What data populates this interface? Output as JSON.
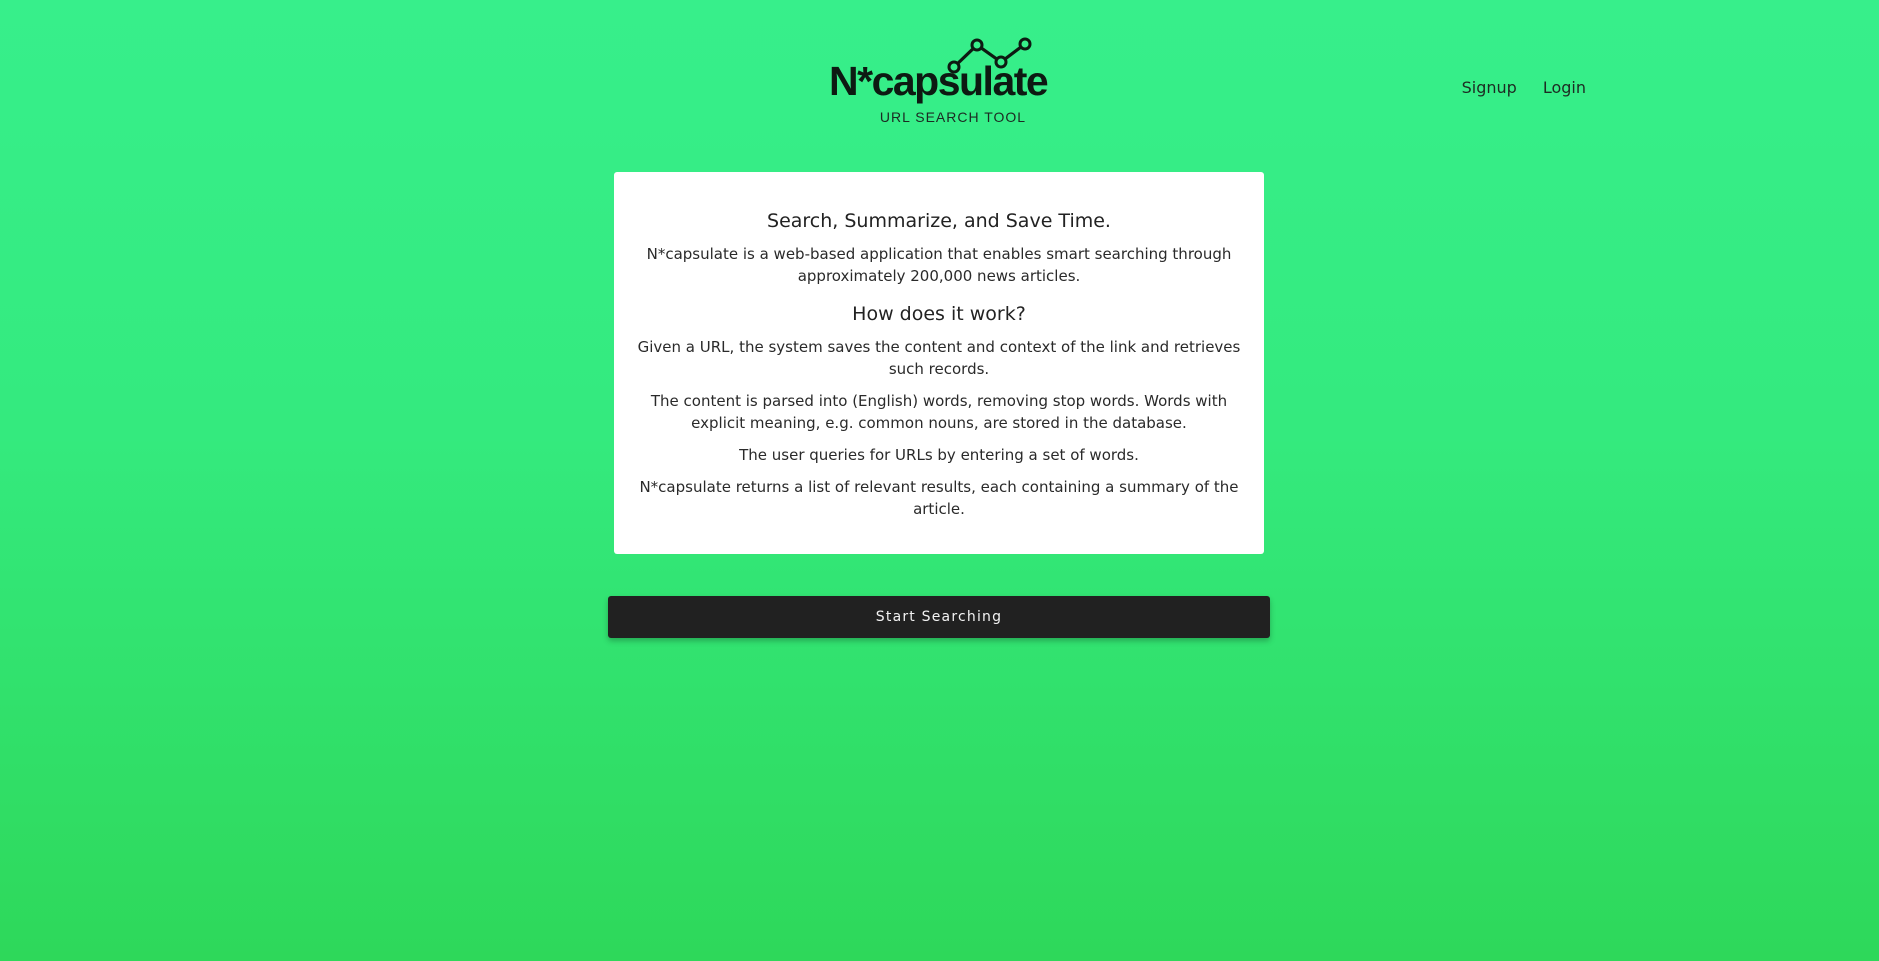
{
  "logo": {
    "wordmark": "N*capsulate",
    "subtitle": "URL SEARCH TOOL",
    "icon": "line-chart-icon"
  },
  "nav": {
    "signup": "Signup",
    "login": "Login"
  },
  "card": {
    "heading": "Search, Summarize, and Save Time.",
    "intro": "N*capsulate is a web-based application that enables smart searching through approximately 200,000 news articles.",
    "how_heading": "How does it work?",
    "steps": [
      "Given a URL, the system saves the content and context of the link and retrieves such records.",
      "The content is parsed into (English) words, removing stop words. Words with explicit meaning, e.g. common nouns, are stored in the database.",
      "The user queries for URLs by entering a set of words.",
      "N*capsulate returns a list of relevant results, each containing a summary of the article."
    ]
  },
  "cta": {
    "label": "Start Searching"
  },
  "colors": {
    "background_top": "#37ef8b",
    "background_bottom": "#2ed85a",
    "button": "#212121",
    "card": "#ffffff"
  }
}
